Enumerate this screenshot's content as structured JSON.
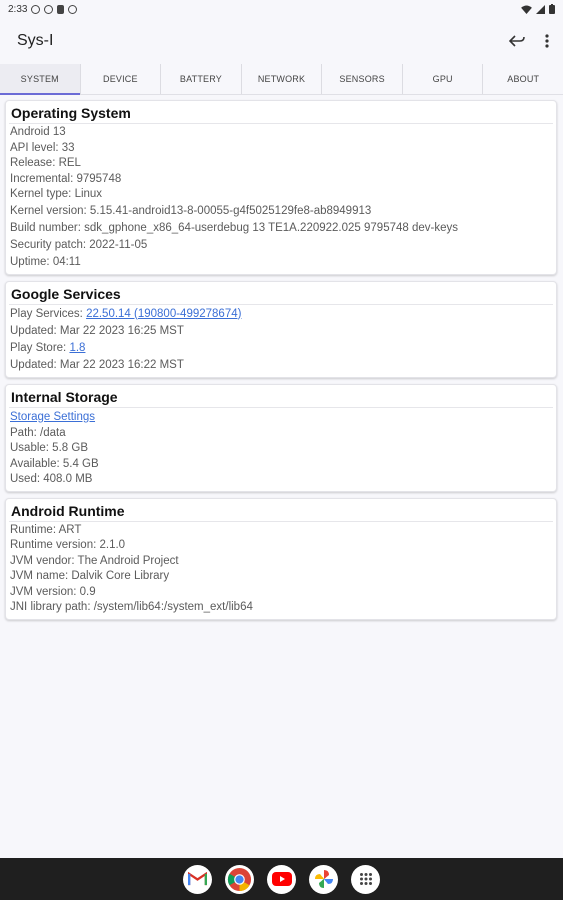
{
  "status": {
    "time": "2:33"
  },
  "app": {
    "title": "Sys-I"
  },
  "tabs": [
    {
      "label": "SYSTEM"
    },
    {
      "label": "DEVICE"
    },
    {
      "label": "BATTERY"
    },
    {
      "label": "NETWORK"
    },
    {
      "label": "SENSORS"
    },
    {
      "label": "GPU"
    },
    {
      "label": "ABOUT"
    }
  ],
  "os": {
    "title": "Operating System",
    "rows": [
      "Android 13",
      "API level: 33",
      "Release: REL",
      "Incremental: 9795748",
      "Kernel type: Linux",
      "Kernel version: 5.15.41-android13-8-00055-g4f5025129fe8-ab8949913",
      "Build number: sdk_gphone_x86_64-userdebug 13 TE1A.220922.025 9795748 dev-keys",
      "Security patch: 2022-11-05",
      "Uptime: 04:11"
    ]
  },
  "google": {
    "title": "Google Services",
    "play_services_label": "Play Services: ",
    "play_services_value": "22.50.14 (190800-499278674)",
    "play_services_updated": "Updated: Mar 22 2023 16:25 MST",
    "play_store_label": "Play Store: ",
    "play_store_value": "1.8",
    "play_store_updated": "Updated: Mar 22 2023 16:22 MST"
  },
  "storage": {
    "title": "Internal Storage",
    "settings_link": "Storage Settings",
    "rows": [
      "Path: /data",
      "Usable: 5.8 GB",
      "Available: 5.4 GB",
      "Used: 408.0 MB"
    ]
  },
  "runtime": {
    "title": "Android Runtime",
    "rows": [
      "Runtime: ART",
      "Runtime version: 2.1.0",
      "JVM vendor: The Android Project",
      "JVM name: Dalvik Core Library",
      "JVM version: 0.9",
      "JNI library path: /system/lib64:/system_ext/lib64"
    ]
  },
  "dock": [
    "gmail-icon",
    "chrome-icon",
    "youtube-icon",
    "photos-icon",
    "app-drawer-icon"
  ],
  "colors": {
    "accent": "#6b6bd6",
    "link": "#3b6fd6"
  }
}
